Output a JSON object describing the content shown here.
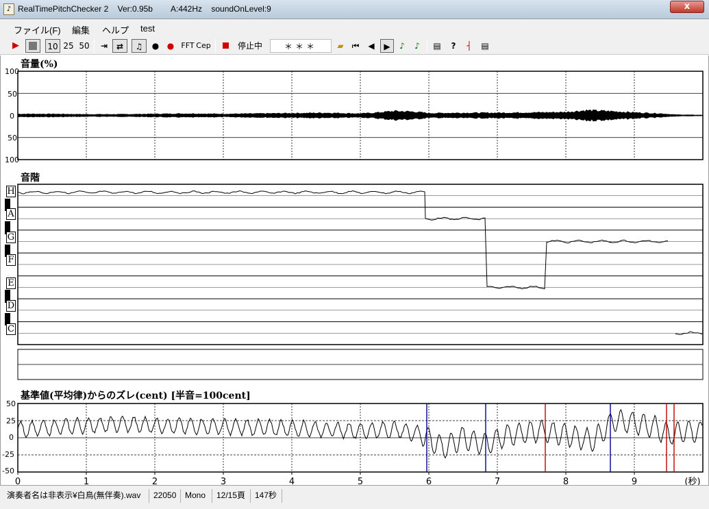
{
  "window": {
    "title": "RealTimePitchChecker 2    Ver:0.95b        A:442Hz    soundOnLevel:9",
    "close_label": "x"
  },
  "menu": [
    "ファイル(F)",
    "編集",
    "ヘルプ",
    "test"
  ],
  "toolbar": {
    "play_icon": "play-icon",
    "speeds": [
      "10",
      "25",
      "50"
    ],
    "fft_label": "FFT",
    "cep_label": "Cep",
    "status_label": "停止中",
    "stars": "＊＊＊"
  },
  "volume_panel": {
    "label": "音量(%)",
    "y_ticks": [
      "100",
      "50",
      "0",
      "50",
      "100"
    ]
  },
  "note_panel": {
    "label": "音階",
    "notes": [
      "H",
      "A",
      "G",
      "F",
      "E",
      "D",
      "C"
    ]
  },
  "cent_panel": {
    "label": "基準値(平均律)からのズレ(cent) [半音=100cent]",
    "y_ticks": [
      "50",
      "25",
      "0",
      "-25",
      "-50"
    ]
  },
  "time_axis": {
    "ticks": [
      "0",
      "1",
      "2",
      "3",
      "4",
      "5",
      "6",
      "7",
      "8",
      "9"
    ],
    "unit": "(秒)"
  },
  "colors": {
    "grid": "#000000",
    "trace": "#000000",
    "marker_red": "#c00000",
    "marker_blue": "#000090"
  },
  "chart_data": [
    {
      "type": "area",
      "ylabel": "音量(%)",
      "ylim": [
        -100,
        100
      ],
      "xlim": [
        0,
        10
      ],
      "grid": true,
      "envelope": {
        "x": [
          0,
          0.5,
          1,
          1.5,
          2,
          2.5,
          3,
          3.5,
          4,
          4.5,
          5,
          5.2,
          5.5,
          5.8,
          6,
          6.5,
          7,
          7.5,
          8,
          8.3,
          8.6,
          9,
          9.4,
          9.6,
          10
        ],
        "amplitude": [
          4,
          4,
          3,
          3,
          4,
          5,
          4,
          5,
          6,
          7,
          5,
          7,
          12,
          10,
          6,
          7,
          7,
          8,
          9,
          14,
          12,
          8,
          5,
          2,
          1
        ]
      }
    },
    {
      "type": "line",
      "ylabel": "音階",
      "categories": [
        "C",
        "D",
        "E",
        "F",
        "G",
        "A",
        "H"
      ],
      "xlim": [
        0,
        10
      ],
      "segments": [
        {
          "x": [
            0,
            5.95
          ],
          "note": "H"
        },
        {
          "x": [
            5.95,
            6.85
          ],
          "note": "A"
        },
        {
          "x": [
            6.85,
            7.72
          ],
          "note": "E"
        },
        {
          "x": [
            7.72,
            8.65
          ],
          "note": "G"
        },
        {
          "x": [
            8.65,
            9.5
          ],
          "note": "G"
        },
        {
          "x": [
            9.6,
            10
          ],
          "note": "C"
        }
      ]
    },
    {
      "type": "line",
      "ylabel": "基準値(平均律)からのズレ(cent) [半音=100cent]",
      "ylim": [
        -50,
        50
      ],
      "xlim": [
        0,
        10
      ],
      "x_unit": "(秒)",
      "x": [
        0,
        0.5,
        1,
        1.5,
        2,
        2.5,
        3,
        3.5,
        4,
        4.5,
        5,
        5.5,
        5.9,
        6.2,
        6.5,
        6.8,
        7.2,
        7.6,
        8,
        8.4,
        8.7,
        9,
        9.3,
        9.5,
        9.8,
        10
      ],
      "y": [
        12,
        15,
        18,
        20,
        18,
        17,
        16,
        15,
        14,
        12,
        10,
        12,
        5,
        -15,
        0,
        -10,
        5,
        10,
        5,
        -5,
        25,
        22,
        15,
        5,
        10,
        8
      ],
      "markers": [
        {
          "x": 5.97,
          "color": "blue"
        },
        {
          "x": 6.83,
          "color": "blue"
        },
        {
          "x": 7.7,
          "color": "red"
        },
        {
          "x": 8.65,
          "color": "blue"
        },
        {
          "x": 9.47,
          "color": "red"
        },
        {
          "x": 9.58,
          "color": "red"
        }
      ]
    }
  ],
  "statusbar": [
    "演奏者名は非表示¥白鳥(無伴奏).wav",
    "22050",
    "Mono",
    "12/15頁",
    "147秒"
  ]
}
